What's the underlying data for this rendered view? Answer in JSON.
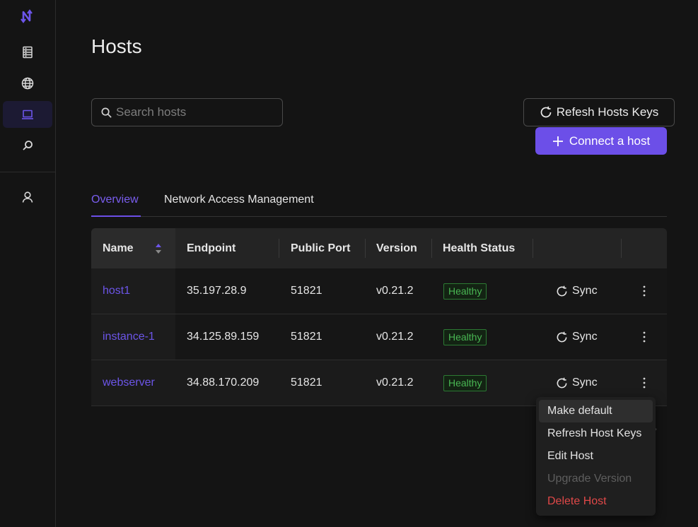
{
  "page": {
    "title": "Hosts"
  },
  "sidebar": {
    "logo": "n-logo-icon",
    "items": [
      {
        "icon": "servers-icon",
        "active": false
      },
      {
        "icon": "globe-icon",
        "active": false
      },
      {
        "icon": "laptop-icon",
        "active": true
      },
      {
        "icon": "search-icon",
        "active": false
      },
      {
        "icon": "user-icon",
        "active": false
      }
    ]
  },
  "search": {
    "placeholder": "Search hosts",
    "value": ""
  },
  "actions": {
    "refresh_label": "Refesh Hosts Keys",
    "connect_label": "Connect a host"
  },
  "tabs": [
    {
      "label": "Overview",
      "active": true
    },
    {
      "label": "Network Access Management",
      "active": false
    }
  ],
  "table": {
    "columns": [
      "Name",
      "Endpoint",
      "Public Port",
      "Version",
      "Health Status"
    ],
    "rows": [
      {
        "name": "host1",
        "endpoint": "35.197.28.9",
        "port": "51821",
        "version": "v0.21.2",
        "health": "Healthy",
        "sync": "Sync"
      },
      {
        "name": "instance-1",
        "endpoint": "34.125.89.159",
        "port": "51821",
        "version": "v0.21.2",
        "health": "Healthy",
        "sync": "Sync"
      },
      {
        "name": "webserver",
        "endpoint": "34.88.170.209",
        "port": "51821",
        "version": "v0.21.2",
        "health": "Healthy",
        "sync": "Sync"
      }
    ]
  },
  "menu": {
    "items": [
      {
        "label": "Make default",
        "state": "hover"
      },
      {
        "label": "Refresh Host Keys",
        "state": "normal"
      },
      {
        "label": "Edit Host",
        "state": "normal"
      },
      {
        "label": "Upgrade Version",
        "state": "disabled"
      },
      {
        "label": "Delete Host",
        "state": "danger"
      }
    ]
  },
  "colors": {
    "accent": "#6c4fe8",
    "healthy": "#49b653",
    "danger": "#e04848",
    "background": "#141414"
  }
}
